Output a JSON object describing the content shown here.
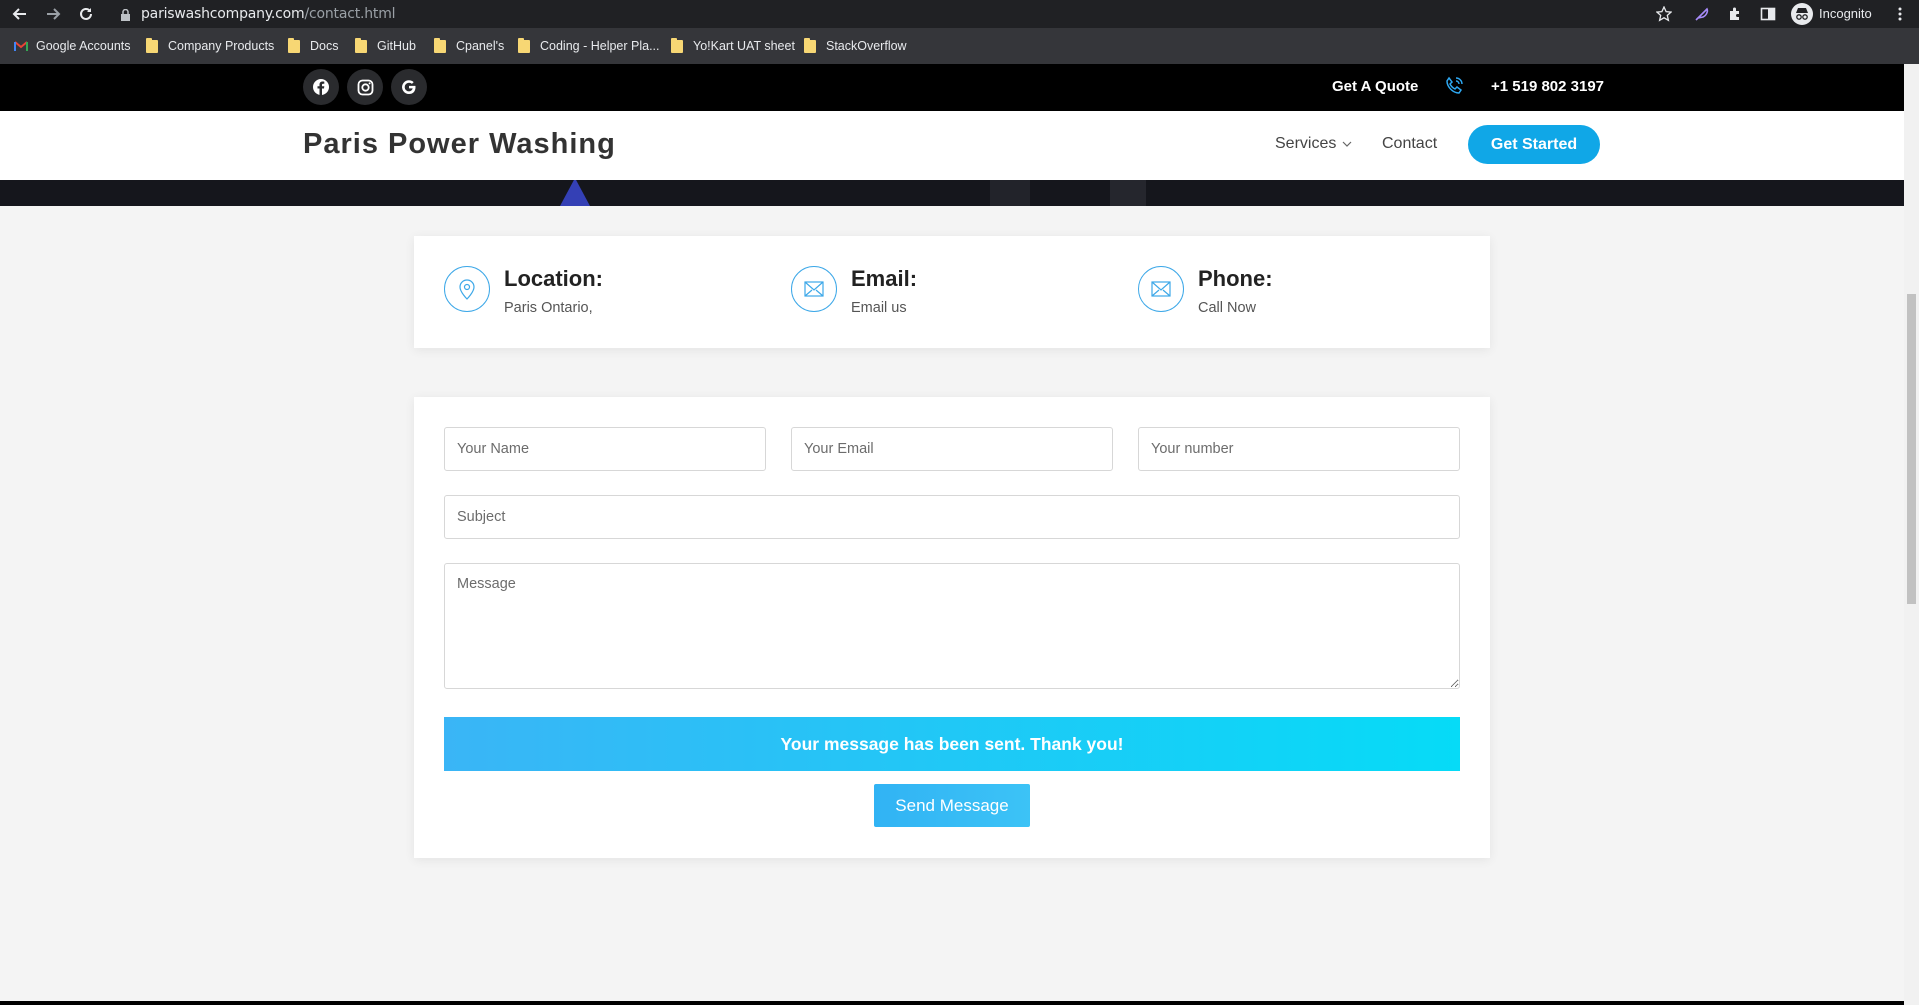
{
  "browser": {
    "url_host": "pariswashcompany.com",
    "url_path": "/contact.html",
    "incognito_label": "Incognito",
    "bookmarks": [
      {
        "label": "Google Accounts",
        "icon": "gmail-icon"
      },
      {
        "label": "Company Products",
        "icon": "folder-icon"
      },
      {
        "label": "Docs",
        "icon": "folder-icon"
      },
      {
        "label": "GitHub",
        "icon": "folder-icon"
      },
      {
        "label": "Cpanel's",
        "icon": "folder-icon"
      },
      {
        "label": "Coding - Helper Pla...",
        "icon": "folder-icon"
      },
      {
        "label": "Yo!Kart UAT sheet",
        "icon": "folder-icon"
      },
      {
        "label": "StackOverflow",
        "icon": "folder-icon"
      }
    ]
  },
  "topbar": {
    "socials": [
      "facebook-icon",
      "instagram-icon",
      "google-icon"
    ],
    "quote_label": "Get A Quote",
    "phone": "+1 519 802 3197"
  },
  "header": {
    "brand": "Paris Power Washing",
    "nav": {
      "services": "Services",
      "contact": "Contact"
    },
    "cta": "Get Started"
  },
  "info": {
    "location": {
      "title": "Location:",
      "text": "Paris Ontario,"
    },
    "email": {
      "title": "Email:",
      "text": "Email us"
    },
    "phone": {
      "title": "Phone:",
      "text": "Call Now"
    }
  },
  "form": {
    "name_placeholder": "Your Name",
    "email_placeholder": "Your Email",
    "number_placeholder": "Your number",
    "subject_placeholder": "Subject",
    "message_placeholder": "Message",
    "success_message": "Your message has been sent. Thank you!",
    "send_label": "Send Message"
  },
  "colors": {
    "accent": "#10a7e7",
    "icon_blue": "#3da8e8"
  }
}
